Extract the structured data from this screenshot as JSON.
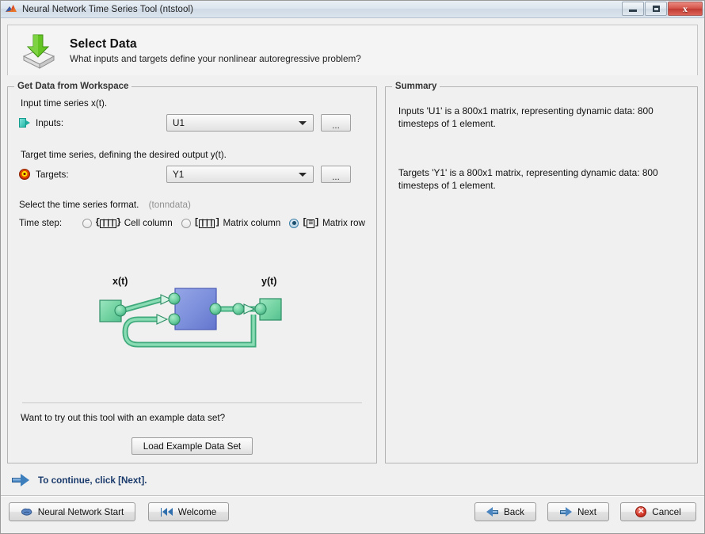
{
  "window": {
    "title": "Neural Network Time Series Tool (ntstool)",
    "app_icon": "matlab-membrane-icon",
    "minimize_label": "",
    "maximize_label": "",
    "close_label": "x"
  },
  "header": {
    "icon": "import-data-icon",
    "title": "Select Data",
    "subtitle": "What inputs and targets define your nonlinear autoregressive problem?"
  },
  "left_panel": {
    "legend": "Get Data from Workspace",
    "input_caption": "Input time series x(t).",
    "inputs": {
      "icon": "input-port-icon",
      "label": "Inputs:",
      "value": "U1",
      "options": [
        "U1"
      ],
      "browse_label": "..."
    },
    "target_caption": "Target time series, defining the desired output y(t).",
    "targets": {
      "icon": "target-bullseye-icon",
      "label": "Targets:",
      "value": "Y1",
      "options": [
        "Y1"
      ],
      "browse_label": "..."
    },
    "format_caption": "Select the time series format.",
    "format_hint": "(tonndata)",
    "timestep_label": "Time step:",
    "format_options": [
      {
        "label": "Cell column",
        "glyph": "{III}",
        "selected": false
      },
      {
        "label": "Matrix column",
        "glyph": "[III]",
        "selected": false
      },
      {
        "label": "Matrix row",
        "glyph": "[=]",
        "selected": true
      }
    ],
    "example_question": "Want to try out this tool with an example data set?",
    "load_example_label": "Load Example Data Set"
  },
  "diagram": {
    "input_label": "x(t)",
    "output_label": "y(t)",
    "block_color": "#7b8edb",
    "node_color": "#66cc9e",
    "wire_color": "#55bf8f"
  },
  "right_panel": {
    "legend": "Summary",
    "paragraphs": [
      "Inputs 'U1' is a 800x1 matrix, representing dynamic data: 800 timesteps of 1 element.",
      "Targets 'Y1' is a 800x1 matrix, representing dynamic data: 800 timesteps of 1 element."
    ]
  },
  "continue": {
    "icon": "arrow-right-icon",
    "text": "To continue, click [Next]."
  },
  "buttons": {
    "neural_network_start": {
      "label": "Neural Network Start",
      "icon": "brain-icon"
    },
    "welcome": {
      "label": "Welcome",
      "icon": "skip-to-start-icon"
    },
    "back": {
      "label": "Back",
      "icon": "arrow-left-icon"
    },
    "next": {
      "label": "Next",
      "icon": "arrow-right-icon"
    },
    "cancel": {
      "label": "Cancel",
      "icon": "cancel-circle-icon"
    }
  },
  "colors": {
    "window_bg": "#f0f0f0",
    "titlebar": "#dbe4ed",
    "accent_blue": "#1a3a6b",
    "panel_border": "#b4b4b4",
    "close_red": "#c63f34"
  }
}
